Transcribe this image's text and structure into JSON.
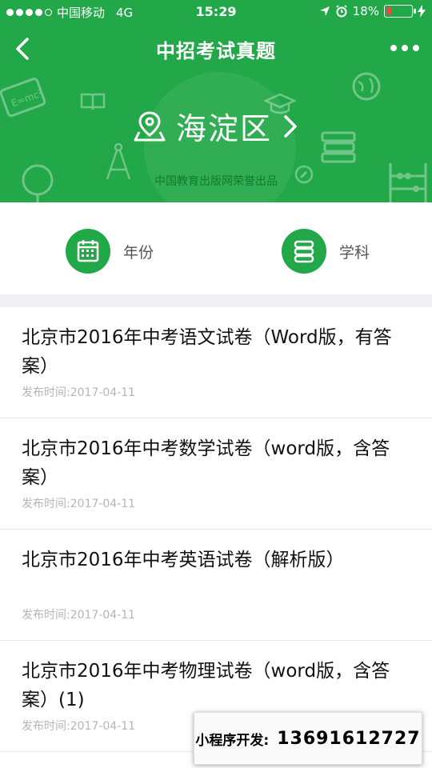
{
  "status": {
    "carrier": "中国移动",
    "network": "4G",
    "time": "15:29",
    "battery": "18%"
  },
  "header": {
    "title": "中招考试真题",
    "district": "海淀区",
    "subtitle": "中国教育出版网荣誉出品"
  },
  "filters": {
    "year_label": "年份",
    "subject_label": "学科"
  },
  "list": [
    {
      "title": "北京市2016年中考语文试卷（Word版，有答案）",
      "date": "发布时间:2017-04-11"
    },
    {
      "title": "北京市2016年中考数学试卷（word版，含答案）",
      "date": "发布时间:2017-04-11"
    },
    {
      "title": "北京市2016年中考英语试卷（解析版）",
      "date": "发布时间:2017-04-11"
    },
    {
      "title": "北京市2016年中考物理试卷（word版，含答案）(1)",
      "date": "发布时间:2017-04-11"
    }
  ],
  "promo": {
    "label": "小程序开发:",
    "phone": "13691612727"
  },
  "colors": {
    "brand": "#22a848",
    "battery_low": "#e74c3c"
  }
}
